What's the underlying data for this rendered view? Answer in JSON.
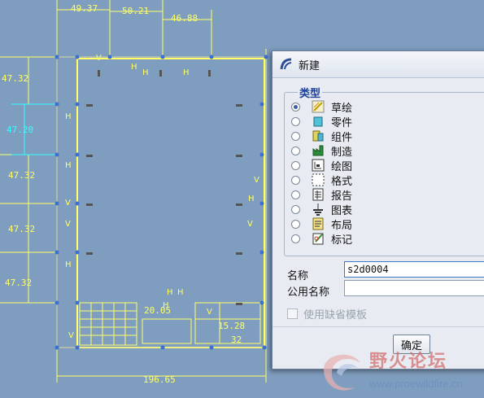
{
  "sketch": {
    "dims_top": [
      "49.37",
      "50.21",
      "46.88"
    ],
    "dims_left": [
      "47.32",
      "47.20",
      "47.32",
      "47.32",
      "47.32"
    ],
    "dims_inner": [
      "20.05",
      "15.28",
      "32"
    ],
    "dim_bottom": "196.65",
    "constraint_h": "H",
    "constraint_v": "V"
  },
  "dialog": {
    "title": "新建",
    "group_label": "类型",
    "types": [
      {
        "label": "草绘",
        "icon": "sketch-icon",
        "selected": true
      },
      {
        "label": "零件",
        "icon": "part-icon",
        "selected": false
      },
      {
        "label": "组件",
        "icon": "assembly-icon",
        "selected": false
      },
      {
        "label": "制造",
        "icon": "manufacturing-icon",
        "selected": false
      },
      {
        "label": "绘图",
        "icon": "drawing-icon",
        "selected": false
      },
      {
        "label": "格式",
        "icon": "format-icon",
        "selected": false
      },
      {
        "label": "报告",
        "icon": "report-icon",
        "selected": false
      },
      {
        "label": "图表",
        "icon": "diagram-icon",
        "selected": false
      },
      {
        "label": "布局",
        "icon": "layout-icon",
        "selected": false
      },
      {
        "label": "标记",
        "icon": "markup-icon",
        "selected": false
      }
    ],
    "name_label": "名称",
    "name_value": "s2d0004",
    "common_name_label": "公用名称",
    "common_name_value": "",
    "default_template_label": "使用缺省模板",
    "ok_label": "确定"
  },
  "watermark": {
    "text": "野火论坛",
    "url": "www.proewildfire.cn"
  }
}
